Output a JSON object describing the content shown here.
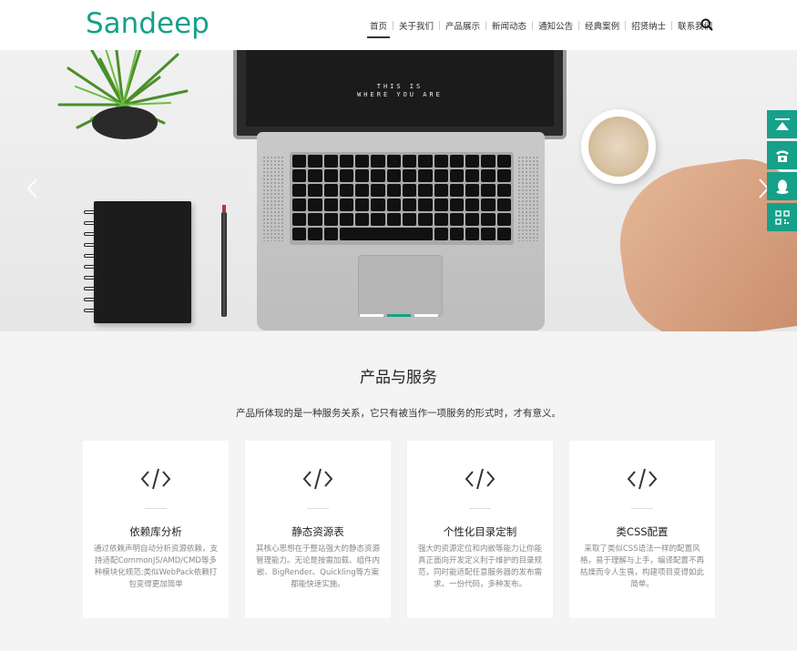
{
  "brand": {
    "logo_text": "Sandeep",
    "accent": "#16a08a"
  },
  "nav": {
    "items": [
      {
        "label": "首页",
        "active": true
      },
      {
        "label": "关于我们"
      },
      {
        "label": "产品展示"
      },
      {
        "label": "新闻动态"
      },
      {
        "label": "通知公告"
      },
      {
        "label": "经典案例"
      },
      {
        "label": "招贤纳士"
      },
      {
        "label": "联系我们"
      }
    ]
  },
  "banner": {
    "screen_line1": "THIS IS",
    "screen_line2": "WHERE YOU ARE",
    "slides_count": 3,
    "active_slide": 2
  },
  "side_tools": [
    "top-icon",
    "phone-icon",
    "qq-icon",
    "qrcode-icon"
  ],
  "products": {
    "title": "产品与服务",
    "subtitle": "产品所体现的是一种服务关系，它只有被当作一项服务的形式时，才有意义。",
    "cards": [
      {
        "title": "依赖库分析",
        "desc": "通过依赖声明自动分析资源依赖，支持适配CommonJS/AMD/CMD等多种模块化规范;类似WebPack依赖打包变得更加简单"
      },
      {
        "title": "静态资源表",
        "desc": "其核心思想在于整站强大的静态资源管理能力。无论是按需加载、组件内嵌、BigRender、Quickling等方案都能快速实施。"
      },
      {
        "title": "个性化目录定制",
        "desc": "强大的资源定位和内嵌等能力让你能真正面向开发定义利于维护的目录规范，同时能适配任意服务器的发布需求。一份代码，多种发布。"
      },
      {
        "title": "类CSS配置",
        "desc": "采取了类似CSS语法一样的配置风格，易于理解与上手，编译配置不再枯燥而令人生畏，构建项目变得如此简单。"
      }
    ]
  }
}
